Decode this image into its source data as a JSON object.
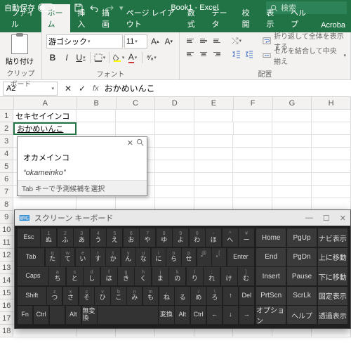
{
  "titlebar": {
    "autosave_label": "自動保存",
    "autosave_state": "オフ",
    "doc": "Book1 - Excel",
    "search_placeholder": "検索"
  },
  "tabs": [
    "ファイル",
    "ホーム",
    "挿入",
    "描画",
    "ページ レイアウト",
    "数式",
    "データ",
    "校閲",
    "表示",
    "ヘルプ",
    "Acroba"
  ],
  "active_tab": 1,
  "ribbon": {
    "paste": "貼り付け",
    "font_name": "游ゴシック",
    "font_size": "11",
    "wrap": "折り返して全体を表示する",
    "merge": "セルを結合して中央揃え",
    "g_clip": "クリップボード",
    "g_font": "フォント",
    "g_align": "配置"
  },
  "namebox": "A2",
  "formula": "おかめいんこ",
  "columns": [
    "A",
    "B",
    "C",
    "D",
    "E",
    "F",
    "G",
    "H"
  ],
  "row_count": 18,
  "cells": {
    "A1": "セキセイインコ",
    "A2": "おかめいんこ"
  },
  "ime": {
    "cand1": "オカメインコ",
    "cand2": "“okameinko”",
    "hint": "Tab キーで予測候補を選択"
  },
  "osk": {
    "title": "スクリーン キーボード",
    "r1": [
      "Esc",
      "1 ぬ",
      "2 ふ",
      "3 あ",
      "4 う",
      "5 え",
      "6 お",
      "7 や",
      "8 ゆ",
      "9 よ",
      "0 わ",
      "- ほ",
      "^ へ",
      "¥ ー"
    ],
    "r2": [
      "Tab",
      "q た",
      "w て",
      "e い",
      "r す",
      "t か",
      "y ん",
      "u な",
      "i に",
      "o ら",
      "p せ",
      "@ ゛",
      "[ ゜",
      "Enter"
    ],
    "r3": [
      "Caps",
      "a ち",
      "s と",
      "d し",
      "f は",
      "g き",
      "h く",
      "j ま",
      "k の",
      "l り",
      ";  れ",
      ":  け",
      "] む"
    ],
    "r4": [
      "Shift",
      "z つ",
      "x さ",
      "c そ",
      "v ひ",
      "b こ",
      "n み",
      "m も",
      ", ね",
      ". る",
      "/ め",
      "\\ ろ",
      "↑",
      "Del"
    ],
    "r5": [
      "Fn",
      "Ctrl",
      "",
      "Alt",
      "無変換",
      "",
      "変換",
      "Alt",
      "Ctrl",
      "←",
      "↓",
      "→"
    ],
    "side": [
      [
        "Home",
        "PgUp",
        "ナビ表示"
      ],
      [
        "End",
        "PgDn",
        "上に移動"
      ],
      [
        "Insert",
        "Pause",
        "下に移動"
      ],
      [
        "PrtScn",
        "ScrLk",
        "固定表示"
      ],
      [
        "オプション",
        "ヘルプ",
        "透過表示"
      ]
    ]
  }
}
